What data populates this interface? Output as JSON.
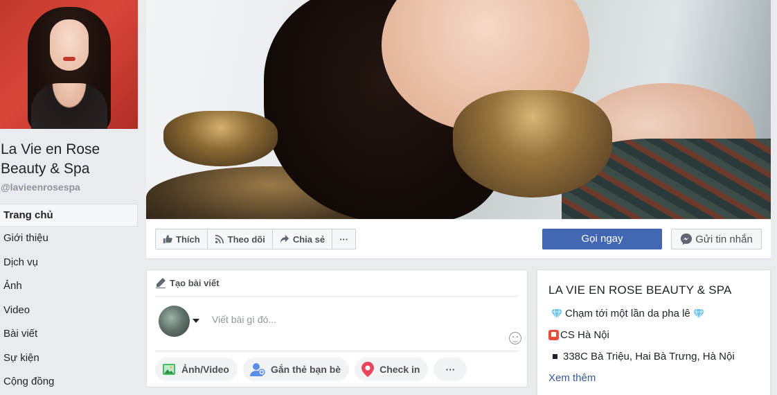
{
  "page": {
    "name": "La Vie en Rose Beauty & Spa",
    "handle": "@lavieenrosespa"
  },
  "nav": {
    "items": [
      {
        "label": "Trang chủ",
        "active": true
      },
      {
        "label": "Giới thiệu"
      },
      {
        "label": "Dịch vụ"
      },
      {
        "label": "Ảnh"
      },
      {
        "label": "Video"
      },
      {
        "label": "Bài viết"
      },
      {
        "label": "Sự kiện"
      },
      {
        "label": "Cộng đồng"
      }
    ]
  },
  "actions": {
    "like": "Thích",
    "follow": "Theo dõi",
    "share": "Chia sẻ",
    "more": "···",
    "call": "Gọi ngay",
    "message": "Gửi tin nhắn"
  },
  "composer": {
    "header": "Tạo bài viết",
    "placeholder": "Viết bài gì đó...",
    "photo_video": "Ảnh/Video",
    "tag_friends": "Gắn thẻ bạn bè",
    "check_in": "Check in",
    "more": "···"
  },
  "info": {
    "title": "LA VIE EN ROSE BEAUTY & SPA",
    "line1": "Chạm tới một lần da pha lê",
    "line2": "CS Hà Nội",
    "line3": "338C Bà Triệu, Hai Bà Trưng, Hà Nội",
    "see_more": "Xem thêm"
  },
  "colors": {
    "primary": "#4267b2",
    "link": "#385898",
    "background": "#e9ebee"
  }
}
